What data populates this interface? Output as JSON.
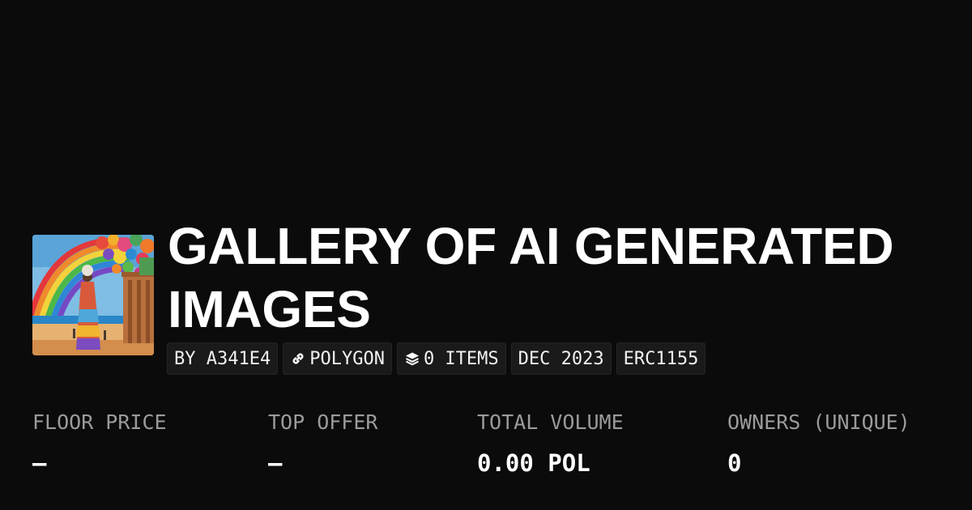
{
  "collection": {
    "title": "GALLERY OF AI GENERATED IMAGES",
    "thumbnail_icon": "collection-artwork"
  },
  "badges": {
    "creator": "BY A341E4",
    "chain": "POLYGON",
    "chain_icon": "link-icon",
    "items": "0 ITEMS",
    "items_icon": "layers-icon",
    "date": "DEC 2023",
    "standard": "ERC1155"
  },
  "stats": {
    "floor_price": {
      "label": "FLOOR PRICE",
      "value": "–"
    },
    "top_offer": {
      "label": "TOP OFFER",
      "value": "–"
    },
    "total_volume": {
      "label": "TOTAL VOLUME",
      "value": "0.00 POL"
    },
    "owners": {
      "label": "OWNERS (UNIQUE)",
      "value": "0"
    }
  }
}
